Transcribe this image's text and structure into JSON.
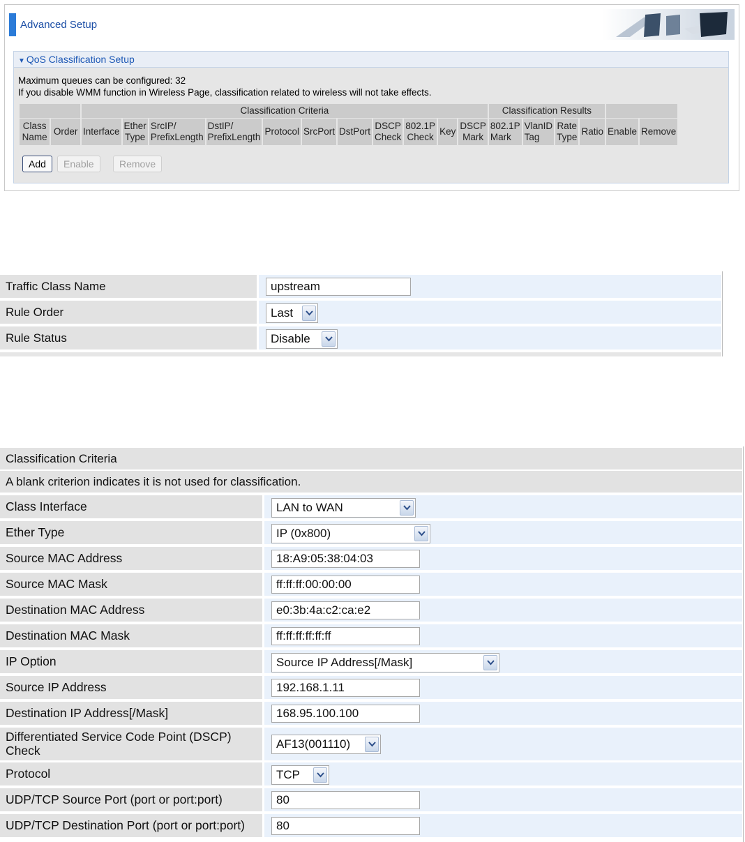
{
  "header": {
    "title": "Advanced Setup"
  },
  "qos": {
    "section_title": "QoS Classification Setup",
    "max_queues_text": "Maximum queues can be configured: 32",
    "wmm_note": "If you disable WMM function in Wireless Page, classification related to wireless will not take effects.",
    "group_headers": {
      "criteria": "Classification Criteria",
      "results": "Classification Results"
    },
    "columns": {
      "class_name": [
        "Class",
        "Name"
      ],
      "order": "Order",
      "interface": "Interface",
      "ether_type": [
        "Ether",
        "Type"
      ],
      "src_ip": [
        "SrcIP/",
        "PrefixLength"
      ],
      "dst_ip": [
        "DstIP/",
        "PrefixLength"
      ],
      "protocol": "Protocol",
      "src_port": "SrcPort",
      "dst_port": "DstPort",
      "dscp_check": [
        "DSCP",
        "Check"
      ],
      "p8021_check": [
        "802.1P",
        "Check"
      ],
      "key": "Key",
      "dscp_mark": [
        "DSCP",
        "Mark"
      ],
      "p8021_mark": [
        "802.1P",
        "Mark"
      ],
      "vlan_tag": [
        "VlanID",
        "Tag"
      ],
      "rate_type": [
        "Rate",
        "Type"
      ],
      "ratio": "Ratio",
      "enable": "Enable",
      "remove": "Remove"
    },
    "buttons": {
      "add": "Add",
      "enable": "Enable",
      "remove": "Remove"
    }
  },
  "traffic": {
    "class_name": {
      "label": "Traffic Class Name",
      "value": "upstream"
    },
    "rule_order": {
      "label": "Rule Order",
      "value": "Last"
    },
    "rule_status": {
      "label": "Rule Status",
      "value": "Disable"
    }
  },
  "criteria": {
    "title": "Classification Criteria",
    "note": "A blank criterion indicates it is not used for classification.",
    "class_interface": {
      "label": "Class Interface",
      "value": "LAN to WAN"
    },
    "ether_type": {
      "label": "Ether Type",
      "value": "IP (0x800)"
    },
    "src_mac": {
      "label": "Source MAC Address",
      "value": "18:A9:05:38:04:03"
    },
    "src_mac_mask": {
      "label": "Source MAC Mask",
      "value": "ff:ff:ff:00:00:00"
    },
    "dst_mac": {
      "label": "Destination MAC Address",
      "value": "e0:3b:4a:c2:ca:e2"
    },
    "dst_mac_mask": {
      "label": "Destination MAC Mask",
      "value": "ff:ff:ff:ff:ff:ff"
    },
    "ip_option": {
      "label": "IP Option",
      "value": "Source IP Address[/Mask]"
    },
    "src_ip": {
      "label": "Source IP Address",
      "value": "192.168.1.11"
    },
    "dst_ip": {
      "label": "Destination IP Address[/Mask]",
      "value": "168.95.100.100"
    },
    "dscp_check": {
      "label_line1": "Differentiated Service Code Point (DSCP)",
      "label_line2": "Check",
      "value": "AF13(001110)"
    },
    "protocol": {
      "label": "Protocol",
      "value": "TCP"
    },
    "src_port": {
      "label": "UDP/TCP Source Port (port or port:port)",
      "value": "80"
    },
    "dst_port": {
      "label": "UDP/TCP Destination Port (port or port:port)",
      "value": "80"
    }
  }
}
